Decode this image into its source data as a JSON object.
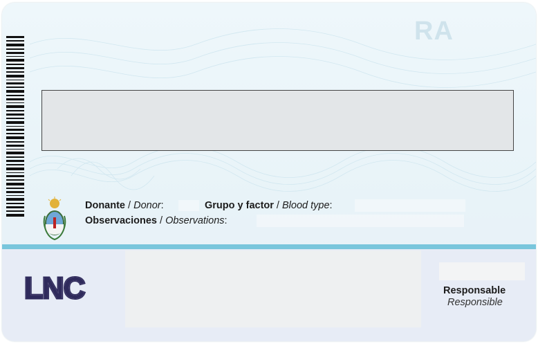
{
  "card": {
    "watermark": "RA",
    "donor": {
      "label_es": "Donante",
      "separator": " / ",
      "label_en": "Donor",
      "colon": ":"
    },
    "blood": {
      "label_es": "Grupo y factor",
      "separator": " / ",
      "label_en": "Blood type",
      "colon": ":"
    },
    "observations": {
      "label_es": "Observaciones",
      "separator": " / ",
      "label_en": "Observations",
      "colon": ":"
    },
    "logo": {
      "text": "LNC"
    },
    "responsible": {
      "label_es": "Responsable",
      "label_en": "Responsible"
    },
    "colors": {
      "stripe": "#79c6dc",
      "logo": "#2f2a5c",
      "background": "#eef7fb"
    },
    "icons": {
      "emblem": "argentine-coat-of-arms-icon",
      "barcode": "barcode-icon"
    }
  }
}
